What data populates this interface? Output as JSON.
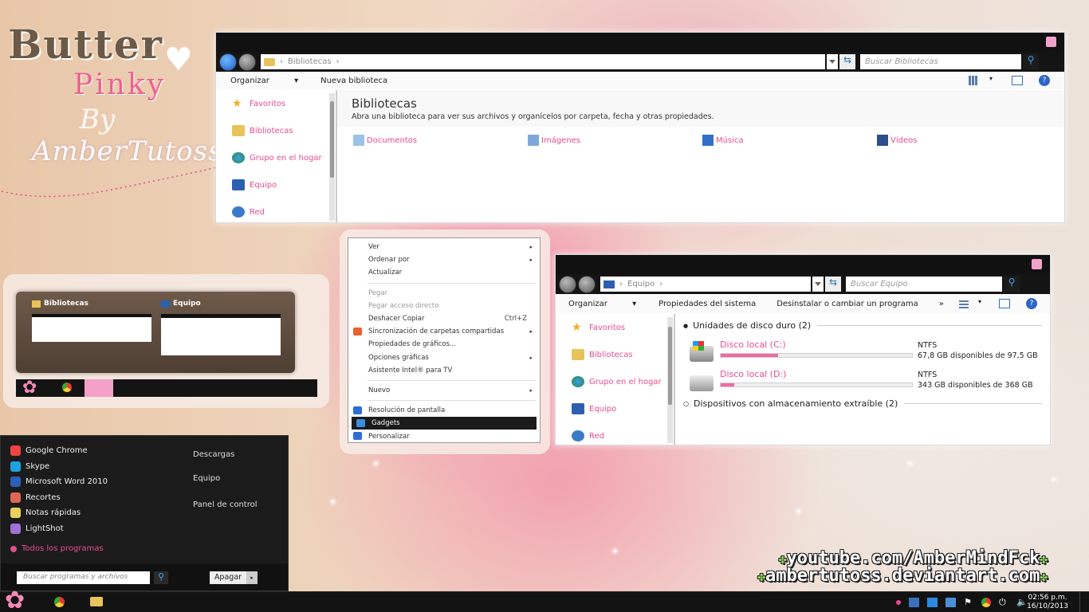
{
  "logo": {
    "line1": "Butter",
    "line2": "Pinky",
    "line3": "By",
    "line4": "AmberTutoss"
  },
  "libraries_window": {
    "breadcrumb": "Bibliotecas",
    "search_placeholder": "Buscar Bibliotecas",
    "toolbar": {
      "organize": "Organizar",
      "new_library": "Nueva biblioteca"
    },
    "nav": [
      "Favoritos",
      "Bibliotecas",
      "Grupo en el hogar",
      "Equipo",
      "Red"
    ],
    "heading": "Bibliotecas",
    "subtitle": "Abra una biblioteca para ver sus archivos y organícelos por carpeta, fecha y otras propiedades.",
    "libraries": [
      "Documentos",
      "Imágenes",
      "Música",
      "Vídeos"
    ]
  },
  "computer_window": {
    "breadcrumb": "Equipo",
    "search_placeholder": "Buscar Equipo",
    "toolbar": {
      "organize": "Organizar",
      "properties": "Propiedades del sistema",
      "uninstall": "Desinstalar o cambiar un programa",
      "more": "»"
    },
    "nav": [
      "Favoritos",
      "Bibliotecas",
      "Grupo en el hogar",
      "Equipo",
      "Red"
    ],
    "hdd_group": "Unidades de disco duro (2)",
    "removable_group": "Dispositivos con almacenamiento extraíble (2)",
    "disks": [
      {
        "name": "Disco local (C:)",
        "fs": "NTFS",
        "free": "67,8 GB disponibles de 97,5 GB",
        "used_fraction": 0.3
      },
      {
        "name": "Disco local (D:)",
        "fs": "NTFS",
        "free": "343 GB disponibles de 368 GB",
        "used_fraction": 0.07
      }
    ]
  },
  "thumbnails": {
    "t1": "Bibliotecas",
    "t2": "Equipo"
  },
  "context_menu": {
    "items": [
      {
        "label": "Ver",
        "arrow": "▸"
      },
      {
        "label": "Ordenar por",
        "arrow": "▸"
      },
      {
        "label": "Actualizar"
      },
      {
        "sep": true
      },
      {
        "label": "Pegar",
        "disabled": true
      },
      {
        "label": "Pegar acceso directo",
        "disabled": true
      },
      {
        "label": "Deshacer Copiar",
        "shortcut": "Ctrl+Z"
      },
      {
        "label": "Sincronización de carpetas compartidas",
        "arrow": "▸",
        "icon": "#e8612c"
      },
      {
        "label": "Propiedades de gráficos..."
      },
      {
        "label": "Opciones gráficas",
        "arrow": "▸"
      },
      {
        "label": "Asistente Intel® para TV"
      },
      {
        "sep": true
      },
      {
        "label": "Nuevo",
        "arrow": "▸"
      },
      {
        "sep": true
      },
      {
        "label": "Resolución de pantalla",
        "icon": "#2c6ed8"
      },
      {
        "label": "Gadgets",
        "selected": true,
        "icon": "#3b8fe0"
      },
      {
        "label": "Personalizar",
        "icon": "#2c6ed8"
      }
    ]
  },
  "start_menu": {
    "programs": [
      {
        "label": "Google Chrome",
        "color": "#e44"
      },
      {
        "label": "Skype",
        "color": "#1fa0e0"
      },
      {
        "label": "Microsoft Word 2010",
        "color": "#2b5fb8"
      },
      {
        "label": "Recortes",
        "color": "#d65"
      },
      {
        "label": "Notas rápidas",
        "color": "#e8d05a"
      },
      {
        "label": "LightShot",
        "color": "#a070d8"
      }
    ],
    "all_programs": "Todos los programas",
    "right": [
      "Descargas",
      "Equipo",
      "Panel de control"
    ],
    "search_placeholder": "Buscar programas y archivos",
    "shutdown": "Apagar"
  },
  "watermark": {
    "line1": "youtube.com/AmberMindFck",
    "line2": "ambertutoss.deviantart.com"
  },
  "clock": {
    "time": "02:56 p.m.",
    "date": "16/10/2013"
  }
}
